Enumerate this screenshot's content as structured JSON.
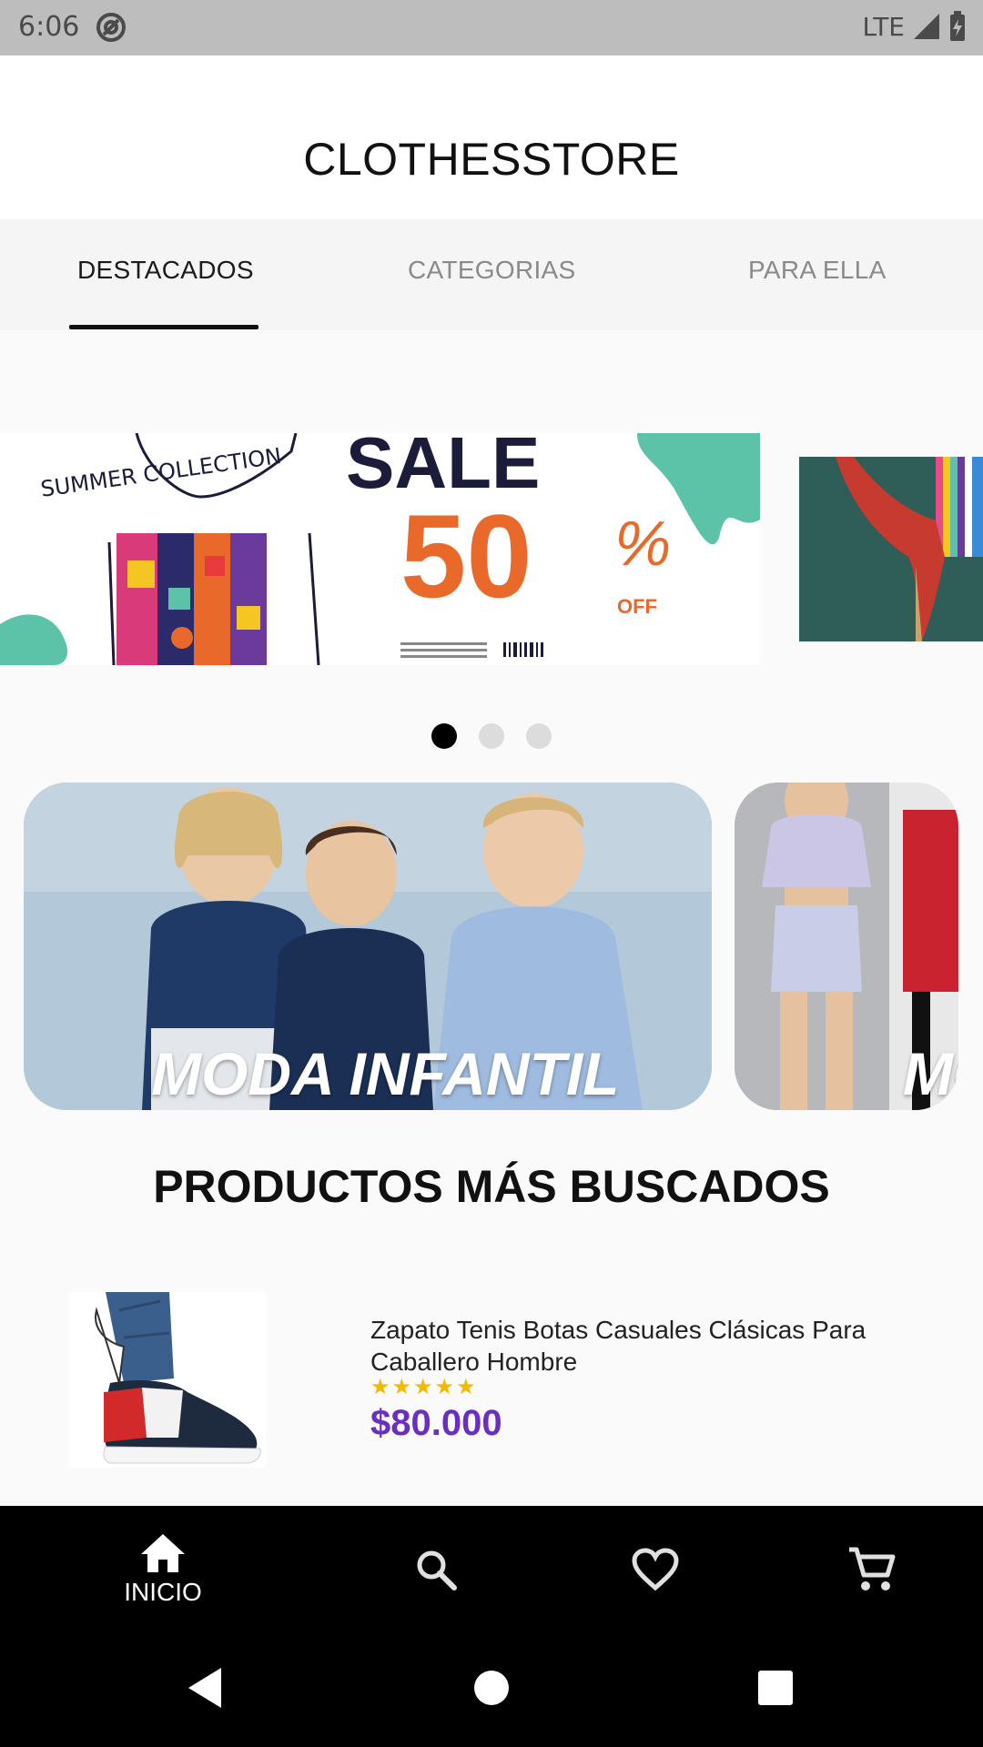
{
  "status_bar": {
    "time": "6:06",
    "network": "LTE",
    "icons": [
      "at-sign-icon",
      "signal-icon",
      "battery-charging-icon"
    ]
  },
  "app_bar": {
    "title": "CLOTHESSTORE"
  },
  "tabs": [
    {
      "label": "DESTACADOS",
      "active": true
    },
    {
      "label": "CATEGORIAS",
      "active": false
    },
    {
      "label": "PARA ELLA",
      "active": false
    }
  ],
  "banners": {
    "current_index": 0,
    "count": 3,
    "banner_1": {
      "badge": "SUMMER COLLECTION",
      "headline": "SALE",
      "percent": "50",
      "percent_sign": "%",
      "off": "OFF"
    }
  },
  "categories": [
    {
      "label": "MODA INFANTIL"
    },
    {
      "label": "MO"
    }
  ],
  "section": {
    "title": "PRODUCTOS MÁS BUSCADOS"
  },
  "products": [
    {
      "name": "Zapato Tenis Botas Casuales Clásicas Para Caballero Hombre",
      "stars": "★★★★★",
      "rating": 5,
      "price": "$80.000"
    }
  ],
  "bottom_nav": {
    "items": [
      {
        "label": "INICIO",
        "icon": "home-icon",
        "active": true
      },
      {
        "label": "",
        "icon": "search-icon",
        "active": false
      },
      {
        "label": "",
        "icon": "heart-icon",
        "active": false
      },
      {
        "label": "",
        "icon": "cart-icon",
        "active": false
      }
    ]
  },
  "colors": {
    "price": "#6a2fc0",
    "star": "#f5b800",
    "sale_orange": "#e8692a",
    "teal": "#5dc3a8"
  }
}
